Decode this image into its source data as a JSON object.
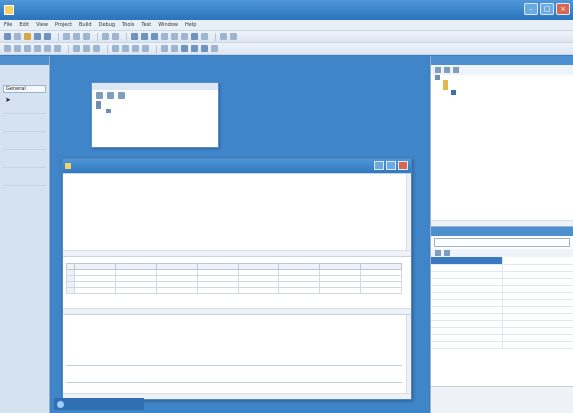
{
  "window": {
    "title": "",
    "icon": "app-icon"
  },
  "menu": {
    "items": [
      "File",
      "Edit",
      "View",
      "Project",
      "Build",
      "Debug",
      "Tools",
      "Test",
      "Window",
      "Help"
    ]
  },
  "toolbox": {
    "header": "",
    "tab_label": "General"
  },
  "object_panel": {
    "title": "",
    "tree": [
      "",
      "",
      ""
    ]
  },
  "table_window": {
    "title": ""
  },
  "grid": {
    "columns": [
      "",
      "",
      "",
      "",
      "",
      "",
      "",
      ""
    ],
    "rows": [
      [
        "",
        "",
        "",
        "",
        "",
        "",
        "",
        ""
      ],
      [
        "",
        "",
        "",
        "",
        "",
        "",
        "",
        ""
      ],
      [
        "",
        "",
        "",
        "",
        "",
        "",
        "",
        ""
      ],
      [
        "",
        "",
        "",
        "",
        "",
        "",
        "",
        ""
      ]
    ]
  },
  "status_tab": {
    "label": ""
  },
  "solution": {
    "header": "",
    "tree": [
      "",
      "",
      "",
      ""
    ]
  },
  "properties": {
    "header": "",
    "object": "",
    "rows": [
      [
        "",
        ""
      ],
      [
        "",
        ""
      ],
      [
        "",
        ""
      ],
      [
        "",
        ""
      ],
      [
        "",
        ""
      ],
      [
        "",
        ""
      ],
      [
        "",
        ""
      ],
      [
        "",
        ""
      ],
      [
        "",
        ""
      ],
      [
        "",
        ""
      ],
      [
        "",
        ""
      ],
      [
        "",
        ""
      ],
      [
        "",
        ""
      ]
    ],
    "desc_title": "",
    "desc_text": ""
  },
  "colors": {
    "accent": "#2a73bd",
    "workspace": "#3f85c8",
    "selection": "#3a78c2"
  }
}
